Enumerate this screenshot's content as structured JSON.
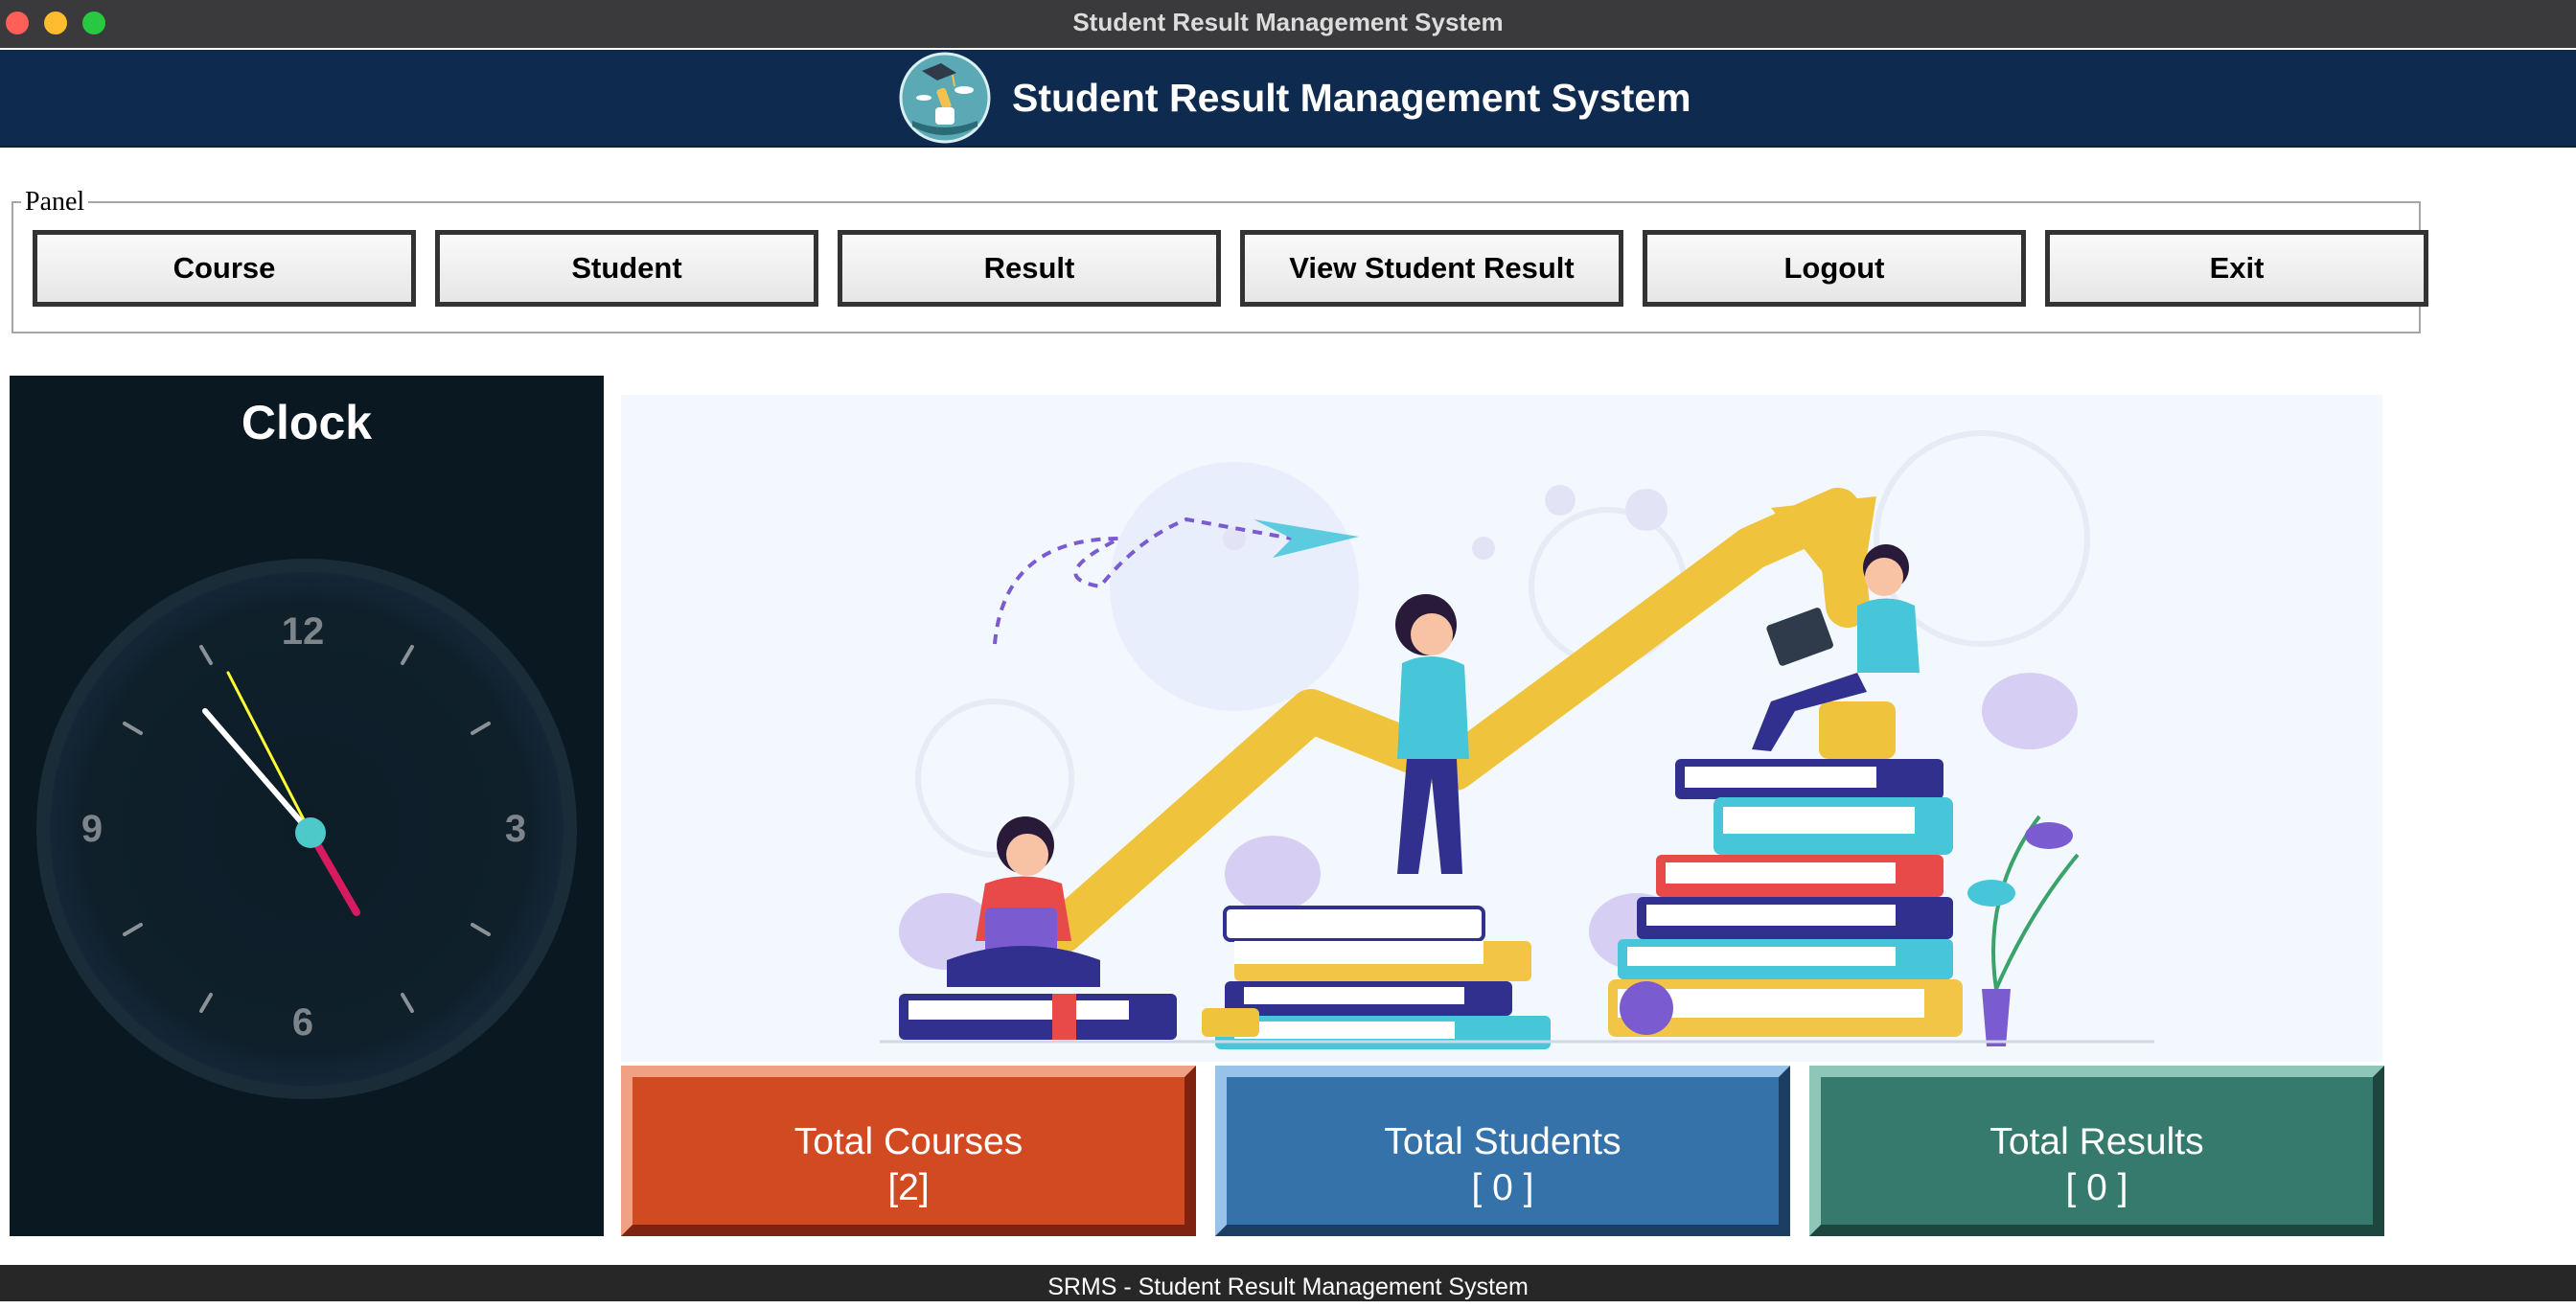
{
  "window": {
    "title": "Student Result Management System"
  },
  "header": {
    "title": "Student Result Management System",
    "logo_icon": "graduate-logo-icon"
  },
  "panel": {
    "legend": "Panel",
    "buttons": [
      "Course",
      "Student",
      "Result",
      "View Student Result",
      "Logout",
      "Exit"
    ]
  },
  "clock": {
    "title": "Clock",
    "numerals": {
      "twelve": "12",
      "three": "3",
      "six": "6",
      "nine": "9"
    },
    "hour_hand_color": "#d81b60",
    "minute_hand_color": "#ffffff",
    "second_hand_color": "#ffff33",
    "center_color": "#4ec9c9"
  },
  "stats": {
    "courses": {
      "label": "Total Courses",
      "value": "[2]"
    },
    "students": {
      "label": "Total Students",
      "value": "[ 0 ]"
    },
    "results": {
      "label": "Total Results",
      "value": "[ 0 ]"
    }
  },
  "colors": {
    "header_bg": "#0f2a4f",
    "courses_bg": "#d14a22",
    "students_bg": "#3572a9",
    "results_bg": "#357a6c",
    "clock_bg": "#0a1821",
    "footer_bg": "#272727"
  },
  "footer": {
    "text": "SRMS - Student Result Management System"
  }
}
